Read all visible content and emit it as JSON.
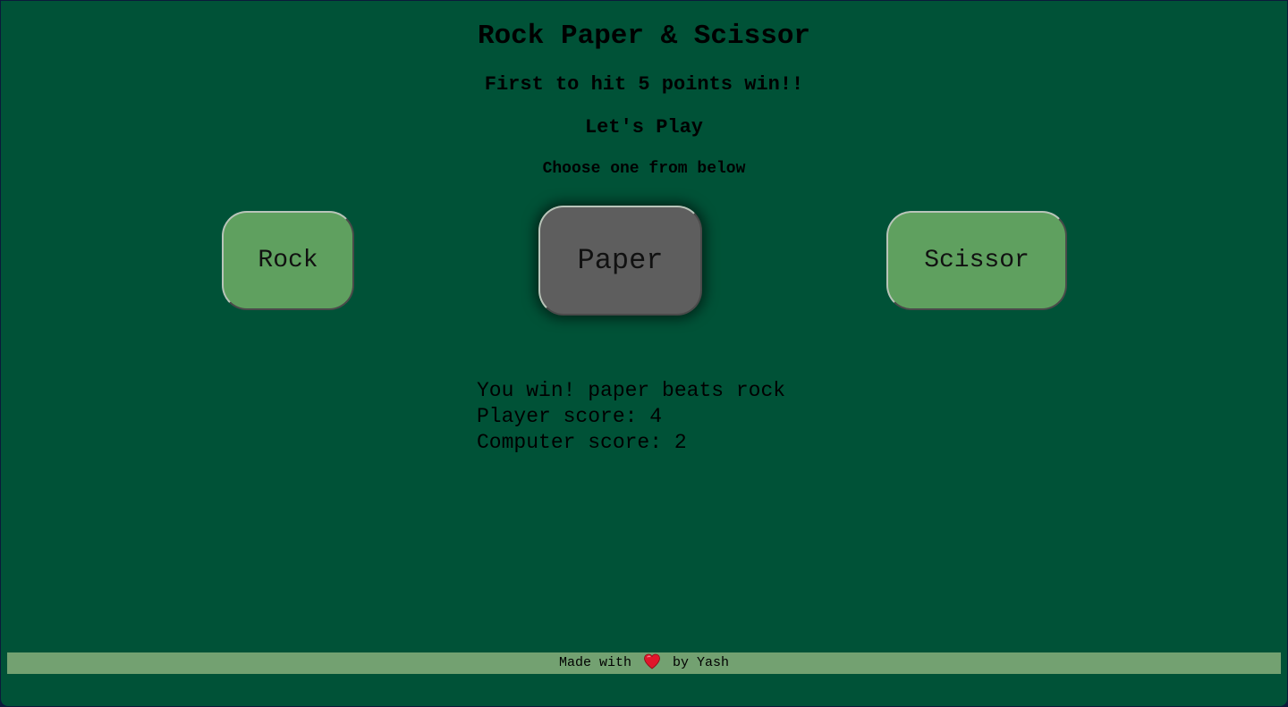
{
  "header": {
    "title": "Rock Paper & Scissor",
    "subtitle": "First to hit 5 points win!!",
    "lets_play": "Let's Play",
    "instruction": "Choose one from below"
  },
  "choices": {
    "rock": "Rock",
    "paper": "Paper",
    "scissor": "Scissor"
  },
  "result": {
    "message": "You win! paper beats rock",
    "player_score": "Player score: 4",
    "computer_score": "Computer score: 2"
  },
  "footer": {
    "prefix": "Made with",
    "icon": "heart-icon",
    "suffix": "by Yash"
  },
  "colors": {
    "background": "#005237",
    "button": "#5fa05f",
    "button_active": "#5e5e5e",
    "footer": "#73a171",
    "heart": "#e0162b"
  }
}
